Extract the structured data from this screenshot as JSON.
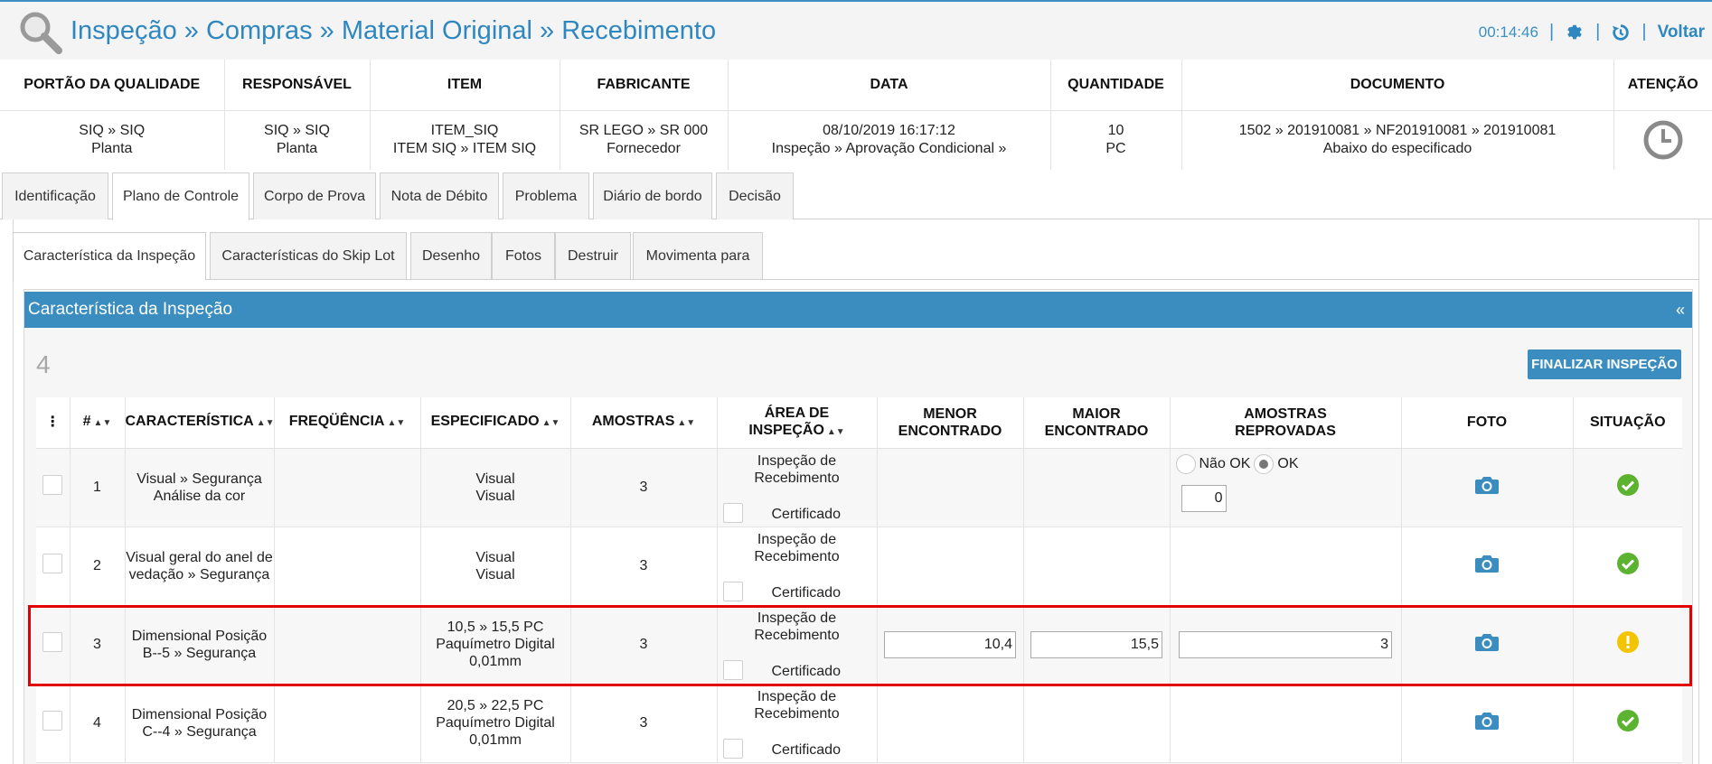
{
  "header": {
    "breadcrumb": "Inspeção » Compras » Material Original » Recebimento",
    "timer": "00:14:46",
    "back_label": "Voltar",
    "icons": [
      "search-icon",
      "gear-icon",
      "history-icon"
    ]
  },
  "info": {
    "columns": [
      "PORTÃO DA QUALIDADE",
      "RESPONSÁVEL",
      "ITEM",
      "FABRICANTE",
      "DATA",
      "QUANTIDADE",
      "DOCUMENTO",
      "ATENÇÃO"
    ],
    "values": [
      [
        "SIQ » SIQ",
        "Planta"
      ],
      [
        "SIQ » SIQ",
        "Planta"
      ],
      [
        "ITEM_SIQ",
        "ITEM SIQ » ITEM SIQ"
      ],
      [
        "SR LEGO » SR 000",
        "Fornecedor"
      ],
      [
        "08/10/2019 16:17:12",
        "Inspeção » Aprovação Condicional »"
      ],
      [
        "10",
        "PC"
      ],
      [
        "1502 » 201910081 » NF201910081 » 201910081",
        "Abaixo do especificado"
      ]
    ],
    "attention_icon": "clock-icon"
  },
  "tabs": [
    "Identificação",
    "Plano de Controle",
    "Corpo de Prova",
    "Nota de Débito",
    "Problema",
    "Diário de bordo",
    "Decisão"
  ],
  "active_tab": "Plano de Controle",
  "subtabs": [
    "Característica da Inspeção",
    "Características do Skip Lot",
    "Desenho",
    "Fotos",
    "Destruir",
    "Movimenta para"
  ],
  "active_subtab": "Característica da Inspeção",
  "section": {
    "title": "Característica da Inspeção",
    "collapse": "«",
    "count": "4",
    "finalize_label": "FINALIZAR INSPEÇÃO"
  },
  "grid": {
    "menu_icon": "⋮",
    "headers": {
      "num": "#",
      "caracteristica": "CARACTERÍSTICA",
      "frequencia": "FREQÜÊNCIA",
      "especificado": "ESPECIFICADO",
      "amostras": "AMOSTRAS",
      "area": "ÁREA DE INSPEÇÃO",
      "menor_1": "MENOR",
      "menor_2": "ENCONTRADO",
      "maior_1": "MAIOR",
      "maior_2": "ENCONTRADO",
      "reprov_1": "AMOSTRAS",
      "reprov_2": "REPROVADAS",
      "foto": "FOTO",
      "situacao": "SITUAÇÃO"
    },
    "area_label_1": "Inspeção de",
    "area_label_2": "Recebimento",
    "cert_label": "Certificado",
    "radio_nok": "Não OK",
    "radio_ok": "OK",
    "rows": [
      {
        "num": "1",
        "car_1": "Visual » Segurança",
        "car_2": "Análise da cor",
        "esp_1": "Visual",
        "esp_2": "Visual",
        "esp_3": "",
        "amostras": "3",
        "menor": "",
        "maior": "",
        "reprov": "0",
        "status": "ok"
      },
      {
        "num": "2",
        "car_1": "Visual geral do anel de",
        "car_2": "vedação » Segurança",
        "esp_1": "Visual",
        "esp_2": "Visual",
        "esp_3": "",
        "amostras": "3",
        "menor": "",
        "maior": "",
        "reprov": "",
        "status": "ok"
      },
      {
        "num": "3",
        "car_1": "Dimensional Posição",
        "car_2": "B--5 » Segurança",
        "esp_1": "10,5 » 15,5 PC",
        "esp_2": "Paquímetro Digital",
        "esp_3": "0,01mm",
        "amostras": "3",
        "menor": "10,4",
        "maior": "15,5",
        "reprov": "3",
        "status": "warning"
      },
      {
        "num": "4",
        "car_1": "Dimensional Posição",
        "car_2": "C--4 » Segurança",
        "esp_1": "20,5 » 22,5 PC",
        "esp_2": "Paquímetro Digital",
        "esp_3": "0,01mm",
        "amostras": "3",
        "menor": "",
        "maior": "",
        "reprov": "",
        "status": "ok"
      }
    ]
  },
  "colors": {
    "primary": "#3a8dbe",
    "ok": "#5cb32f",
    "warning": "#f2c500",
    "highlight": "#e30000"
  }
}
